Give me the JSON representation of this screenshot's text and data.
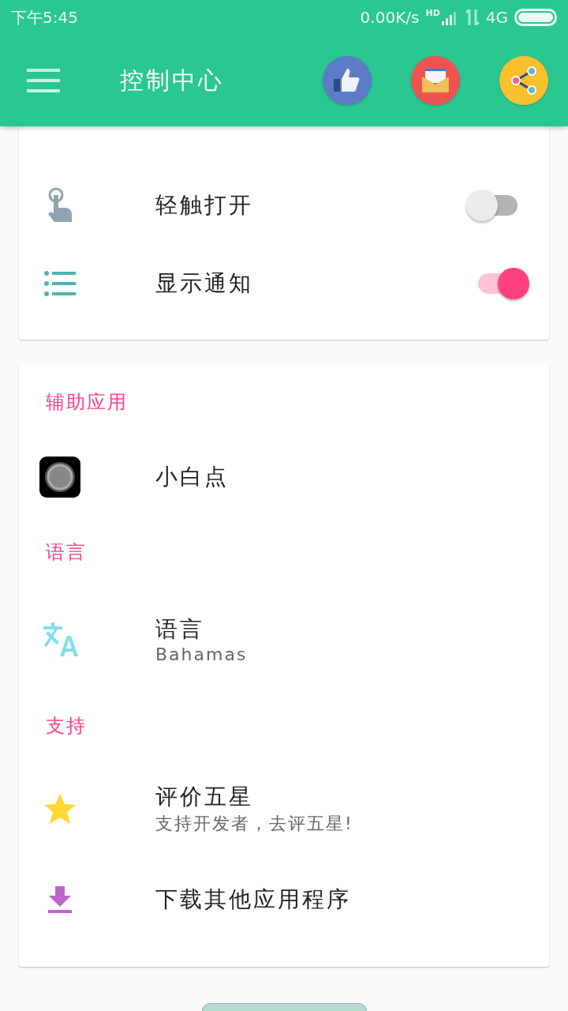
{
  "status_bar": {
    "time": "下午5:45",
    "speed": "0.00K/s",
    "hd": "HD",
    "network": "4G"
  },
  "toolbar": {
    "title": "控制中心",
    "actions": [
      {
        "kind": "like"
      },
      {
        "kind": "mail"
      },
      {
        "kind": "share"
      }
    ]
  },
  "settings_card": {
    "rows": [
      {
        "kind": "touch",
        "label": "轻触打开",
        "on": false
      },
      {
        "kind": "list",
        "label": "显示通知",
        "on": true
      }
    ]
  },
  "main_card": {
    "sections": [
      {
        "title": "辅助应用",
        "items": [
          {
            "kind": "dot",
            "title": "小白点"
          }
        ]
      },
      {
        "title": "语言",
        "items": [
          {
            "kind": "translate",
            "title": "语言",
            "subtitle": "Bahamas"
          }
        ]
      },
      {
        "title": "支持",
        "items": [
          {
            "kind": "star",
            "title": "评价五星",
            "subtitle": "支持开发者，去评五星!"
          },
          {
            "kind": "download",
            "title": "下载其他应用程序"
          }
        ]
      }
    ]
  },
  "footer_button": {
    "kind": "button"
  }
}
